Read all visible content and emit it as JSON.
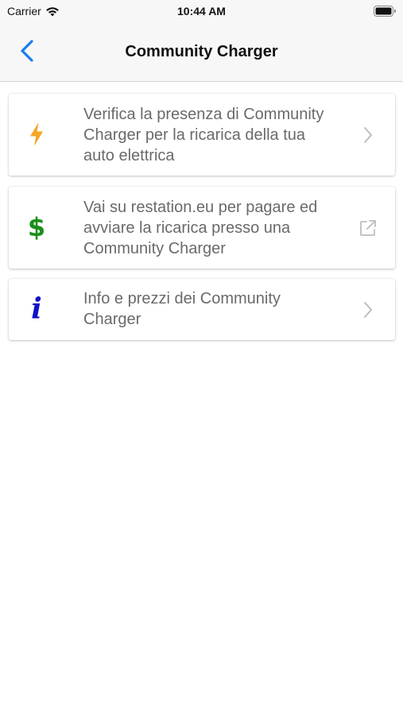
{
  "status_bar": {
    "carrier": "Carrier",
    "time": "10:44 AM",
    "wifi_icon": "wifi-icon",
    "battery_icon": "battery-icon"
  },
  "nav": {
    "title": "Community Charger",
    "back_icon": "chevron-left-icon",
    "accent_color": "#1a7cf0"
  },
  "items": [
    {
      "icon": "lightning-bolt-icon",
      "icon_color": "#f5a623",
      "text": "Verifica la presenza di Community Charger per la ricarica della tua auto elettrica",
      "accessory": "chevron-right-icon"
    },
    {
      "icon": "dollar-icon",
      "icon_glyph": "$",
      "icon_color": "#1a8f1a",
      "text": "Vai su restation.eu per pagare ed avviare la ricarica presso una Community Charger",
      "accessory": "external-link-icon"
    },
    {
      "icon": "info-icon",
      "icon_glyph": "i",
      "icon_color": "#1010c8",
      "text": "Info e prezzi dei Community Charger",
      "accessory": "chevron-right-icon"
    }
  ]
}
